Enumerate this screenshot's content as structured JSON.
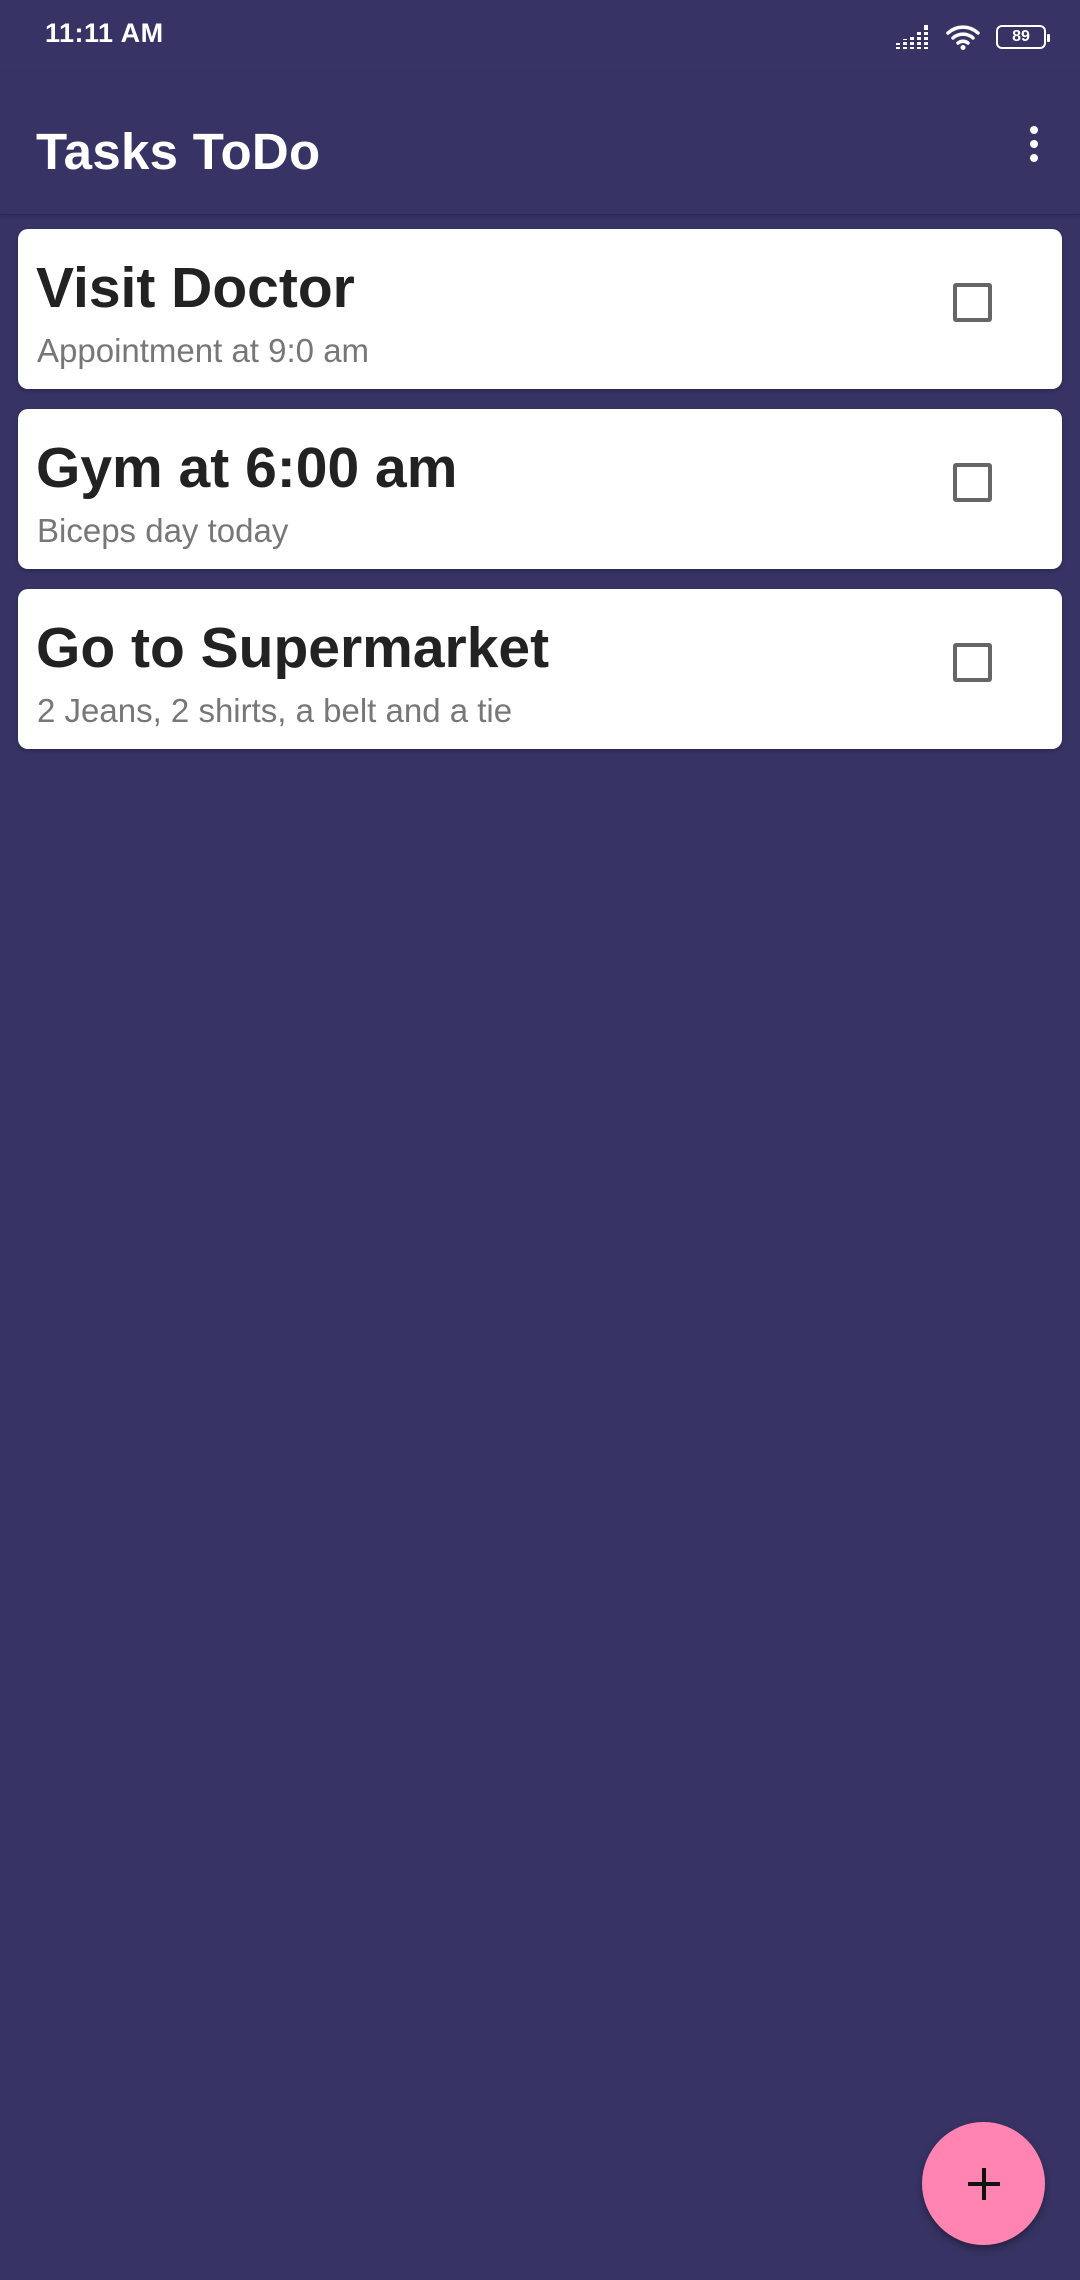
{
  "status_bar": {
    "time": "11:11 AM",
    "battery_level": "89",
    "icons": [
      "signal-icon",
      "wifi-icon",
      "battery-icon"
    ]
  },
  "app_bar": {
    "title": "Tasks ToDo",
    "menu_icon": "more-vert-icon"
  },
  "tasks": [
    {
      "title": "Visit Doctor",
      "subtitle": "Appointment at 9:0 am",
      "checked": false
    },
    {
      "title": "Gym at 6:00 am",
      "subtitle": "Biceps day today",
      "checked": false
    },
    {
      "title": "Go to Supermarket",
      "subtitle": "2 Jeans, 2 shirts, a belt and a tie",
      "checked": false
    }
  ],
  "fab": {
    "icon": "plus-icon"
  },
  "colors": {
    "background": "#373465",
    "card": "#ffffff",
    "fab": "#ff84b2",
    "title_text": "#222222",
    "subtitle_text": "#777777"
  }
}
